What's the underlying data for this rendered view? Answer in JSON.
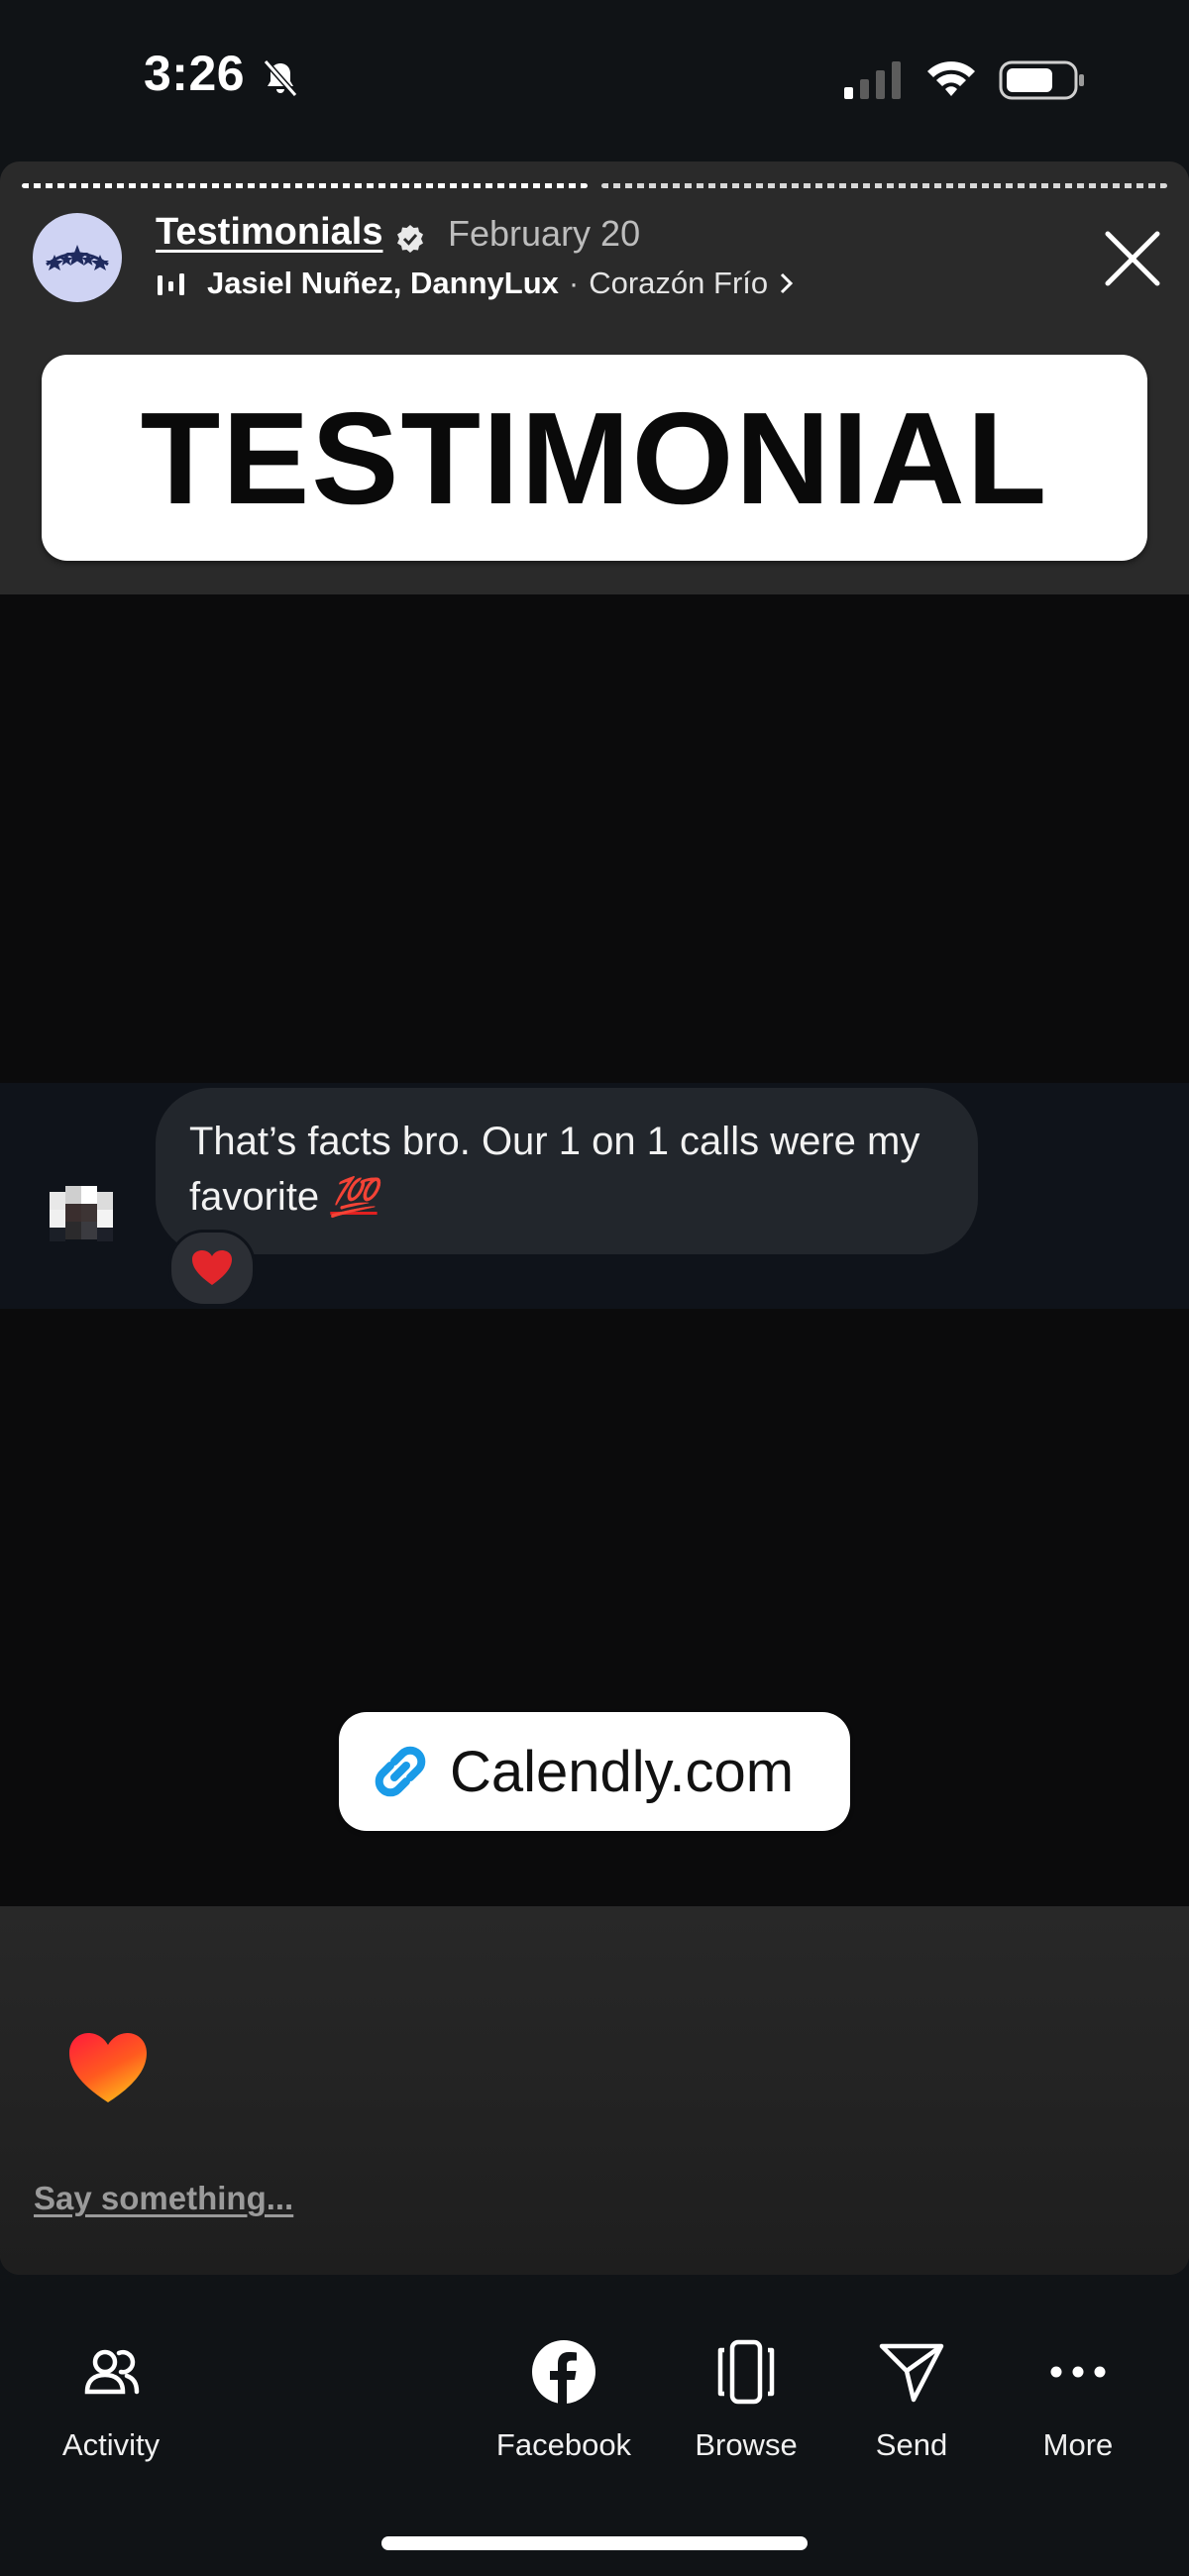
{
  "status_bar": {
    "time": "3:26",
    "icons": [
      "bell-slash-icon",
      "signal-icon",
      "wifi-icon",
      "battery-icon"
    ]
  },
  "story": {
    "account_name": "Testimonials",
    "date": "February 20",
    "music_artists": "Jasiel Nuñez, DannyLux",
    "music_separator": "·",
    "music_song": "Corazón Frío",
    "banner_text": "TESTIMONIAL",
    "message_text": "That’s facts bro. Our 1 on 1 calls were my favorite",
    "message_emoji": "💯",
    "reaction_emoji": "heart-icon",
    "link_sticker_text": "Calendly.com",
    "reply_placeholder": "Say something...",
    "progress_segments": 2
  },
  "bottom_nav": {
    "activity": "Activity",
    "facebook": "Facebook",
    "browse": "Browse",
    "send": "Send",
    "more": "More"
  },
  "colors": {
    "background": "#101316",
    "story_dark": "#0b0b0c",
    "bubble": "#22262c",
    "link_blue": "#1a9be8",
    "heart_red": "#e3262b"
  }
}
